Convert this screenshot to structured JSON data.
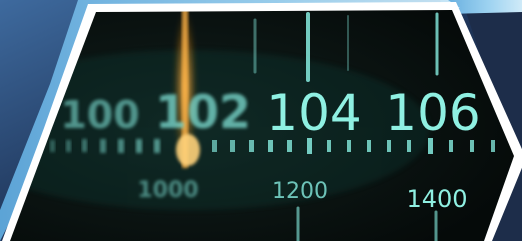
{
  "dial": {
    "fm_labels": [
      "100",
      "102",
      "104",
      "106"
    ],
    "am_labels": [
      "1000",
      "1200",
      "1400"
    ],
    "colors": {
      "background": "#1c2a44",
      "frame_white": "#ffffff",
      "frame_blue": "#8ec9ee",
      "dial_face": "#07100f",
      "teal_marks": "#7fe0d4",
      "needle_orange": "#ffb347"
    }
  }
}
